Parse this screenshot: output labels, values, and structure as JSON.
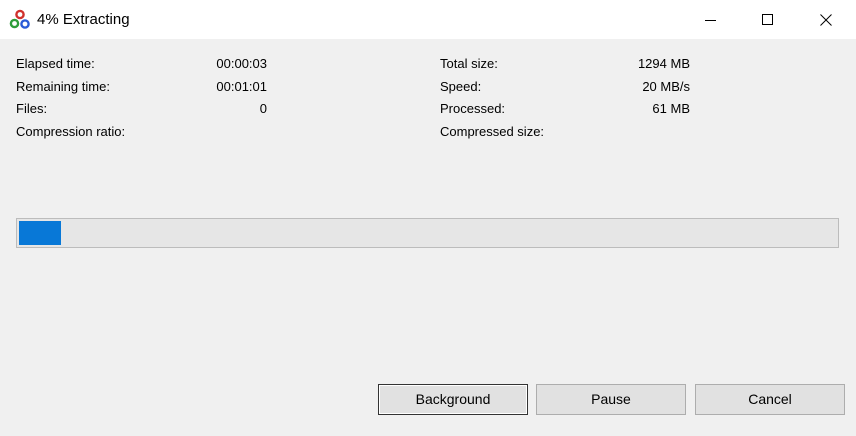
{
  "window": {
    "title": "4% Extracting",
    "controls": [
      "minimize-icon",
      "maximize-icon",
      "close-icon"
    ]
  },
  "stats_left": [
    {
      "label": "Elapsed time:",
      "value": "00:00:03"
    },
    {
      "label": "Remaining time:",
      "value": "00:01:01"
    },
    {
      "label": "Files:",
      "value": "0"
    },
    {
      "label": "Compression ratio:",
      "value": ""
    }
  ],
  "stats_right": [
    {
      "label": "Total size:",
      "value": "1294 MB"
    },
    {
      "label": "Speed:",
      "value": "20 MB/s"
    },
    {
      "label": "Processed:",
      "value": "61 MB"
    },
    {
      "label": "Compressed size:",
      "value": ""
    }
  ],
  "progress": {
    "percent": 4,
    "color": "#0878d7"
  },
  "buttons": {
    "background": "Background",
    "pause": "Pause",
    "cancel": "Cancel"
  }
}
